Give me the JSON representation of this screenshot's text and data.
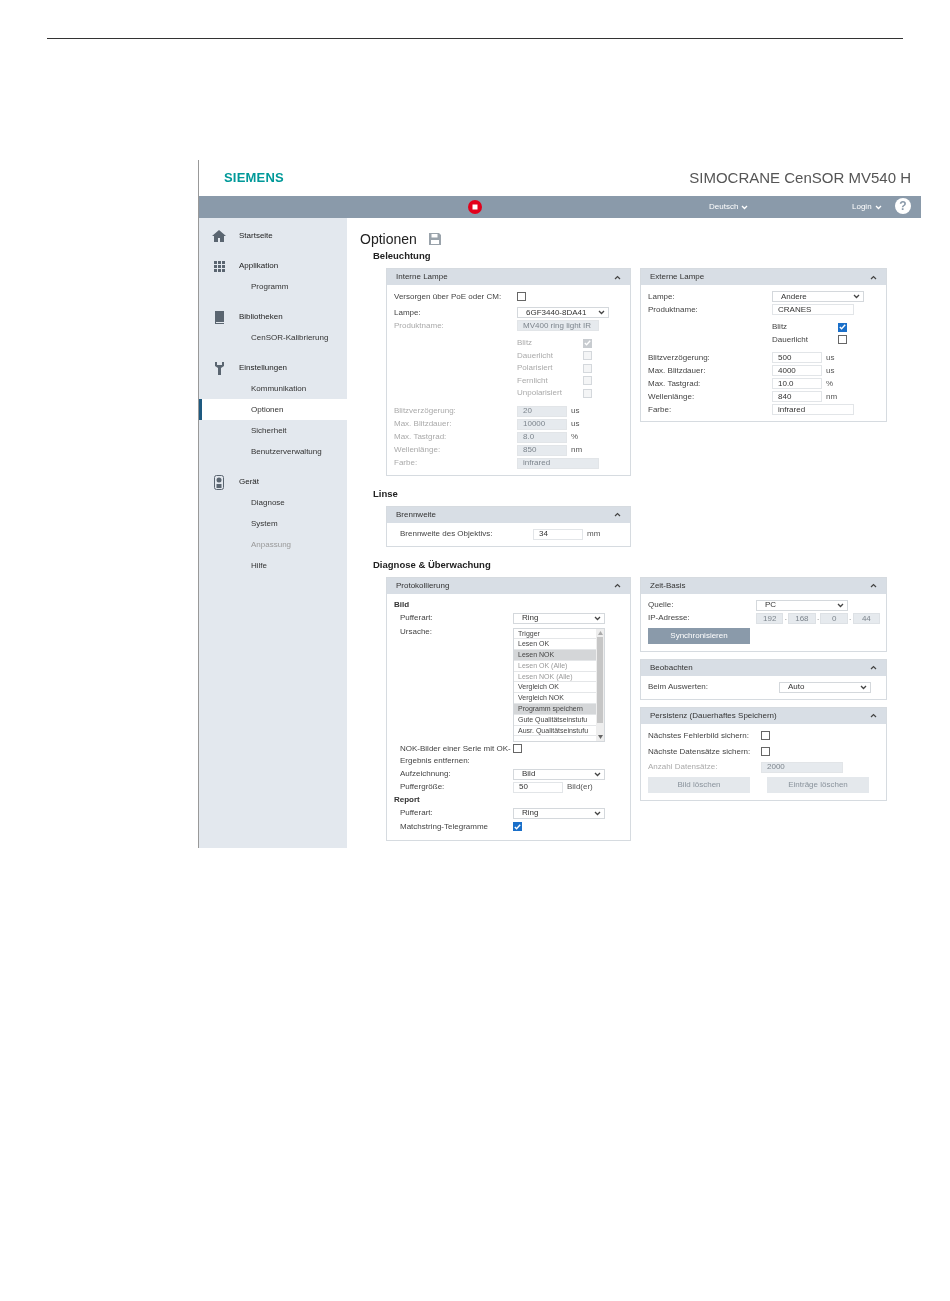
{
  "header": {
    "brand": "SIEMENS",
    "product": "SIMOCRANE CenSOR MV540 H"
  },
  "toolbar": {
    "language": "Deutsch",
    "login": "Login",
    "help": "?"
  },
  "sidebar": [
    {
      "label": "Startseite"
    },
    {
      "label": "Applikation",
      "children": [
        {
          "label": "Programm",
          "selected": false,
          "disabled": false
        }
      ]
    },
    {
      "label": "Bibliotheken",
      "children": [
        {
          "label": "CenSOR-Kalibrierung",
          "selected": false,
          "disabled": false
        }
      ]
    },
    {
      "label": "Einstellungen",
      "children": [
        {
          "label": "Kommunikation",
          "selected": false,
          "disabled": false
        },
        {
          "label": "Optionen",
          "selected": true,
          "disabled": false
        },
        {
          "label": "Sicherheit",
          "selected": false,
          "disabled": false
        },
        {
          "label": "Benutzerverwaltung",
          "selected": false,
          "disabled": false
        }
      ]
    },
    {
      "label": "Gerät",
      "children": [
        {
          "label": "Diagnose",
          "selected": false,
          "disabled": false
        },
        {
          "label": "System",
          "selected": false,
          "disabled": false
        },
        {
          "label": "Anpassung",
          "selected": false,
          "disabled": true
        },
        {
          "label": "Hilfe",
          "selected": false,
          "disabled": false
        }
      ]
    }
  ],
  "page": {
    "title": "Optionen"
  },
  "sections": [
    {
      "title": "Beleuchtung",
      "columns": [
        [
          {
            "title": "Interne Lampe",
            "fields": [
              {
                "kind": "checkbox",
                "label": "Versorgen über PoE oder CM:",
                "checked": false,
                "disabled": false
              },
              {
                "kind": "select",
                "label": "Lampe:",
                "value": "6GF3440-8DA41",
                "disabled": false
              },
              {
                "kind": "input",
                "label": "Produktname:",
                "value": "MV400 ring light IR",
                "disabled": true
              },
              {
                "kind": "flags",
                "items": [
                  {
                    "label": "Blitz",
                    "checked": true,
                    "disabled": true
                  },
                  {
                    "label": "Dauerlicht",
                    "checked": false,
                    "disabled": true
                  },
                  {
                    "label": "Polarisiert",
                    "checked": false,
                    "disabled": true
                  },
                  {
                    "label": "Fernlicht",
                    "checked": false,
                    "disabled": true
                  },
                  {
                    "label": "Unpolarisiert",
                    "checked": false,
                    "disabled": true
                  }
                ]
              },
              {
                "kind": "input",
                "label": "Blitzverzögerung:",
                "value": "20",
                "unit": "us",
                "disabled": true
              },
              {
                "kind": "input",
                "label": "Max. Blitzdauer:",
                "value": "10000",
                "unit": "us",
                "disabled": true
              },
              {
                "kind": "input",
                "label": "Max. Tastgrad:",
                "value": "8.0",
                "unit": "%",
                "disabled": true
              },
              {
                "kind": "input",
                "label": "Wellenlänge:",
                "value": "850",
                "unit": "nm",
                "disabled": true
              },
              {
                "kind": "input",
                "label": "Farbe:",
                "value": "infrared",
                "disabled": true
              }
            ]
          }
        ],
        [
          {
            "title": "Externe Lampe",
            "fields": [
              {
                "kind": "select",
                "label": "Lampe:",
                "value": "Andere",
                "disabled": false
              },
              {
                "kind": "input",
                "label": "Produktname:",
                "value": "CRANES",
                "disabled": false
              },
              {
                "kind": "flags",
                "items": [
                  {
                    "label": "Blitz",
                    "checked": true,
                    "disabled": false
                  },
                  {
                    "label": "Dauerlicht",
                    "checked": false,
                    "disabled": false
                  }
                ]
              },
              {
                "kind": "input",
                "label": "Blitzverzögerung:",
                "value": "500",
                "unit": "us",
                "disabled": false
              },
              {
                "kind": "input",
                "label": "Max. Blitzdauer:",
                "value": "4000",
                "unit": "us",
                "disabled": false
              },
              {
                "kind": "input",
                "label": "Max. Tastgrad:",
                "value": "10.0",
                "unit": "%",
                "disabled": false
              },
              {
                "kind": "input",
                "label": "Wellenlänge:",
                "value": "840",
                "unit": "nm",
                "disabled": false
              },
              {
                "kind": "input",
                "label": "Farbe:",
                "value": "infrared",
                "disabled": false
              }
            ]
          }
        ]
      ]
    },
    {
      "title": "Linse",
      "columns": [
        [
          {
            "title": "Brennweite",
            "fields": [
              {
                "kind": "input",
                "label": "Brennweite des Objektivs:",
                "value": "34",
                "unit": "mm",
                "disabled": false
              }
            ]
          }
        ]
      ]
    },
    {
      "title": "Diagnose & Überwachung",
      "columns": [
        [
          {
            "title": "Protokollierung",
            "fields": [
              {
                "kind": "group",
                "label": "Bild",
                "fields": [
                  {
                    "kind": "select",
                    "label": "Pufferart:",
                    "value": "Ring",
                    "disabled": false
                  },
                  {
                    "kind": "listbox",
                    "label": "Ursache:",
                    "options": [
                      {
                        "label": "Trigger",
                        "selected": false,
                        "disabled": false
                      },
                      {
                        "label": "Lesen OK",
                        "selected": false,
                        "disabled": false
                      },
                      {
                        "label": "Lesen NOK",
                        "selected": true,
                        "disabled": false
                      },
                      {
                        "label": "Lesen OK (Alle)",
                        "selected": false,
                        "disabled": true
                      },
                      {
                        "label": "Lesen NOK (Alle)",
                        "selected": false,
                        "disabled": true
                      },
                      {
                        "label": "Vergleich OK",
                        "selected": false,
                        "disabled": false
                      },
                      {
                        "label": "Vergleich NOK",
                        "selected": false,
                        "disabled": false
                      },
                      {
                        "label": "Programm speichern",
                        "selected": true,
                        "disabled": false
                      },
                      {
                        "label": "Gute Qualitätseinstufu",
                        "selected": false,
                        "disabled": false
                      },
                      {
                        "label": "Ausr. Qualitätseinstufu",
                        "selected": false,
                        "disabled": false
                      }
                    ]
                  },
                  {
                    "kind": "checkbox",
                    "label": "NOK-Bilder einer Serie mit OK-Ergebnis entfernen:",
                    "checked": false,
                    "disabled": false
                  },
                  {
                    "kind": "select",
                    "label": "Aufzeichnung:",
                    "value": "Bild",
                    "disabled": false
                  },
                  {
                    "kind": "input",
                    "label": "Puffergröße:",
                    "value": "50",
                    "unit": "Bild(er)",
                    "disabled": false
                  }
                ]
              },
              {
                "kind": "group",
                "label": "Report",
                "fields": [
                  {
                    "kind": "select",
                    "label": "Pufferart:",
                    "value": "Ring",
                    "disabled": false
                  },
                  {
                    "kind": "checkbox",
                    "label": "Matchstring-Telegramme",
                    "checked": true,
                    "disabled": false
                  }
                ]
              }
            ]
          }
        ],
        [
          {
            "title": "Zeit-Basis",
            "fields": [
              {
                "kind": "select",
                "label": "Quelle:",
                "value": "PC",
                "disabled": false
              },
              {
                "kind": "ip",
                "label": "IP-Adresse:",
                "parts": [
                  "192",
                  "168",
                  "0",
                  "44"
                ],
                "separator": ".",
                "disabled": true
              },
              {
                "kind": "buttons",
                "items": [
                  {
                    "label": "Synchronisieren",
                    "disabled": false
                  }
                ]
              }
            ]
          },
          {
            "title": "Beobachten",
            "fields": [
              {
                "kind": "select",
                "label": "Beim Auswerten:",
                "value": "Auto",
                "disabled": false
              }
            ]
          },
          {
            "title": "Persistenz (Dauerhaftes Speichern)",
            "fields": [
              {
                "kind": "checkbox",
                "label": "Nächstes Fehlerbild sichern:",
                "checked": false,
                "disabled": false
              },
              {
                "kind": "checkbox",
                "label": "Nächste Datensätze sichern:",
                "checked": false,
                "disabled": false
              },
              {
                "kind": "input",
                "label": "Anzahl Datensätze:",
                "value": "2000",
                "disabled": true
              },
              {
                "kind": "buttons",
                "items": [
                  {
                    "label": "Bild löschen",
                    "disabled": true
                  },
                  {
                    "label": "Einträge löschen",
                    "disabled": true
                  }
                ]
              }
            ]
          }
        ]
      ]
    }
  ]
}
